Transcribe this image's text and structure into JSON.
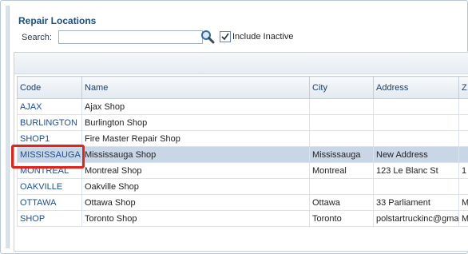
{
  "panel": {
    "title": "Repair Locations",
    "search_label": "Search:",
    "search_value": "",
    "include_inactive_label": "Include Inactive",
    "include_inactive_checked": true
  },
  "table": {
    "columns": [
      "Code",
      "Name",
      "City",
      "Address",
      "Z"
    ],
    "rows": [
      {
        "code": "AJAX",
        "name": "Ajax Shop",
        "city": "",
        "address": "",
        "z": ""
      },
      {
        "code": "BURLINGTON",
        "name": "Burlington Shop",
        "city": "",
        "address": "",
        "z": ""
      },
      {
        "code": "SHOP1",
        "name": "Fire Master Repair Shop",
        "city": "",
        "address": "",
        "z": ""
      },
      {
        "code": "MISSISSAUGA",
        "name": "Mississauga Shop",
        "city": "Mississauga",
        "address": "New Address",
        "z": ""
      },
      {
        "code": "MONTREAL",
        "name": "Montreal Shop",
        "city": "Montreal",
        "address": "123 Le Blanc St",
        "z": "1"
      },
      {
        "code": "OAKVILLE",
        "name": "Oakville Shop",
        "city": "",
        "address": "",
        "z": ""
      },
      {
        "code": "OTTAWA",
        "name": "Ottawa Shop",
        "city": "Ottawa",
        "address": "33 Parliament",
        "z": "M"
      },
      {
        "code": "SHOP",
        "name": "Toronto Shop",
        "city": "Toronto",
        "address": "polstartruckinc@gmai",
        "z": "M"
      }
    ],
    "selected_code": "MISSISSAUGA"
  },
  "colors": {
    "title": "#1d4f80",
    "selected_row": "#c9d6e6",
    "highlight": "#e0231b"
  },
  "icons": {
    "search": "magnifier-icon",
    "check": "checkmark-icon"
  }
}
